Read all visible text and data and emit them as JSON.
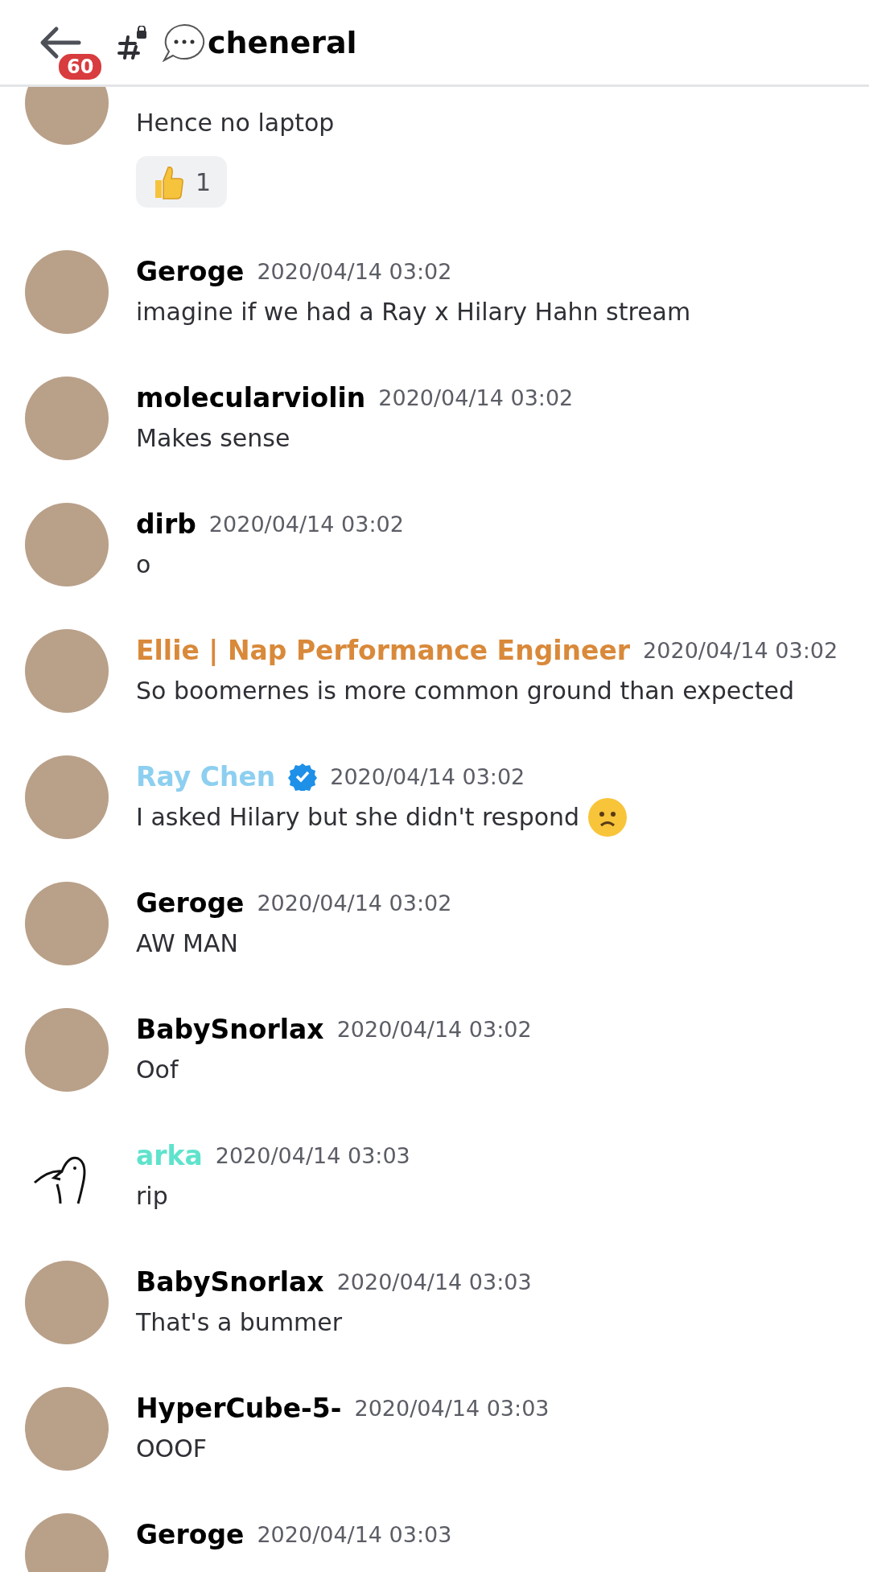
{
  "header": {
    "unread_badge": "60",
    "channel_name": "cheneral"
  },
  "messages": [
    {
      "kind": "continued",
      "avatar": {
        "kind": "photo"
      },
      "text": "Hence no laptop",
      "reactions": [
        {
          "count": "1",
          "selected": false
        }
      ]
    },
    {
      "kind": "full",
      "avatar": {
        "kind": "photo"
      },
      "author": "Geroge",
      "color": "#000000",
      "verified": false,
      "time": "2020/04/14 03:02",
      "text": "imagine if we had a Ray x Hilary Hahn stream"
    },
    {
      "kind": "full",
      "avatar": {
        "kind": "photo"
      },
      "author": "molecularviolin",
      "color": "#000000",
      "verified": false,
      "time": "2020/04/14 03:02",
      "text": "Makes sense"
    },
    {
      "kind": "full",
      "avatar": {
        "kind": "photo"
      },
      "author": "dirb",
      "color": "#000000",
      "verified": false,
      "time": "2020/04/14 03:02",
      "text": "o"
    },
    {
      "kind": "full",
      "avatar": {
        "kind": "photo"
      },
      "author": "Ellie | Nap Performance Engineer",
      "color": "#d9893a",
      "verified": false,
      "time": "2020/04/14 03:02",
      "text": "So boomernes is more common ground than expected"
    },
    {
      "kind": "full",
      "avatar": {
        "kind": "photo"
      },
      "author": "Ray Chen",
      "color": "#8dcff0",
      "verified": true,
      "time": "2020/04/14 03:02",
      "text": "I asked Hilary but she didn't respond",
      "emoji": {
        "kind": "frown"
      }
    },
    {
      "kind": "full",
      "avatar": {
        "kind": "photo"
      },
      "author": "Geroge",
      "color": "#000000",
      "verified": false,
      "time": "2020/04/14 03:02",
      "text": "AW MAN"
    },
    {
      "kind": "full",
      "avatar": {
        "kind": "photo"
      },
      "author": "BabySnorlax",
      "color": "#000000",
      "verified": false,
      "time": "2020/04/14 03:02",
      "text": "Oof"
    },
    {
      "kind": "full",
      "avatar": {
        "kind": "bird"
      },
      "author": "arka",
      "color": "#5fe3cc",
      "verified": false,
      "time": "2020/04/14 03:03",
      "text": "rip"
    },
    {
      "kind": "full",
      "avatar": {
        "kind": "photo"
      },
      "author": "BabySnorlax",
      "color": "#000000",
      "verified": false,
      "time": "2020/04/14 03:03",
      "text": "That's a bummer"
    },
    {
      "kind": "full",
      "avatar": {
        "kind": "photo"
      },
      "author": "HyperCube-5-",
      "color": "#000000",
      "verified": false,
      "time": "2020/04/14 03:03",
      "text": "OOOF"
    },
    {
      "kind": "full",
      "avatar": {
        "kind": "photo"
      },
      "author": "Geroge",
      "color": "#000000",
      "verified": false,
      "time": "2020/04/14 03:03"
    }
  ]
}
